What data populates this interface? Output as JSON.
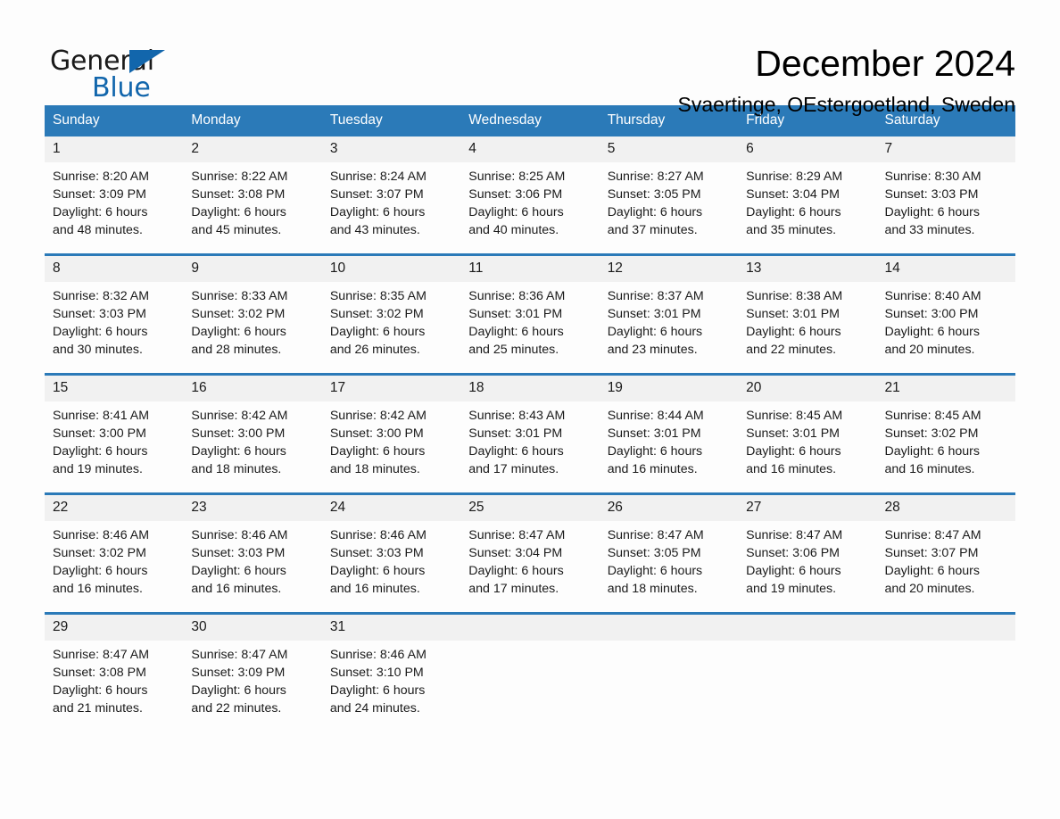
{
  "logo": {
    "word_one": "General",
    "word_two": "Blue",
    "flag_icon": "triangle-flag-icon"
  },
  "header": {
    "title": "December 2024",
    "subtitle": "Svaertinge, OEstergoetland, Sweden"
  },
  "colors": {
    "header_blue": "#2b7ab8",
    "logo_blue": "#1266ac",
    "daynum_band": "#f1f1f1",
    "page_background": "#fdfdfd"
  },
  "calendar": {
    "weekday_headers": [
      "Sunday",
      "Monday",
      "Tuesday",
      "Wednesday",
      "Thursday",
      "Friday",
      "Saturday"
    ],
    "weeks": [
      [
        {
          "day": "1",
          "sunrise": "Sunrise: 8:20 AM",
          "sunset": "Sunset: 3:09 PM",
          "daylight_line1": "Daylight: 6 hours",
          "daylight_line2": "and 48 minutes."
        },
        {
          "day": "2",
          "sunrise": "Sunrise: 8:22 AM",
          "sunset": "Sunset: 3:08 PM",
          "daylight_line1": "Daylight: 6 hours",
          "daylight_line2": "and 45 minutes."
        },
        {
          "day": "3",
          "sunrise": "Sunrise: 8:24 AM",
          "sunset": "Sunset: 3:07 PM",
          "daylight_line1": "Daylight: 6 hours",
          "daylight_line2": "and 43 minutes."
        },
        {
          "day": "4",
          "sunrise": "Sunrise: 8:25 AM",
          "sunset": "Sunset: 3:06 PM",
          "daylight_line1": "Daylight: 6 hours",
          "daylight_line2": "and 40 minutes."
        },
        {
          "day": "5",
          "sunrise": "Sunrise: 8:27 AM",
          "sunset": "Sunset: 3:05 PM",
          "daylight_line1": "Daylight: 6 hours",
          "daylight_line2": "and 37 minutes."
        },
        {
          "day": "6",
          "sunrise": "Sunrise: 8:29 AM",
          "sunset": "Sunset: 3:04 PM",
          "daylight_line1": "Daylight: 6 hours",
          "daylight_line2": "and 35 minutes."
        },
        {
          "day": "7",
          "sunrise": "Sunrise: 8:30 AM",
          "sunset": "Sunset: 3:03 PM",
          "daylight_line1": "Daylight: 6 hours",
          "daylight_line2": "and 33 minutes."
        }
      ],
      [
        {
          "day": "8",
          "sunrise": "Sunrise: 8:32 AM",
          "sunset": "Sunset: 3:03 PM",
          "daylight_line1": "Daylight: 6 hours",
          "daylight_line2": "and 30 minutes."
        },
        {
          "day": "9",
          "sunrise": "Sunrise: 8:33 AM",
          "sunset": "Sunset: 3:02 PM",
          "daylight_line1": "Daylight: 6 hours",
          "daylight_line2": "and 28 minutes."
        },
        {
          "day": "10",
          "sunrise": "Sunrise: 8:35 AM",
          "sunset": "Sunset: 3:02 PM",
          "daylight_line1": "Daylight: 6 hours",
          "daylight_line2": "and 26 minutes."
        },
        {
          "day": "11",
          "sunrise": "Sunrise: 8:36 AM",
          "sunset": "Sunset: 3:01 PM",
          "daylight_line1": "Daylight: 6 hours",
          "daylight_line2": "and 25 minutes."
        },
        {
          "day": "12",
          "sunrise": "Sunrise: 8:37 AM",
          "sunset": "Sunset: 3:01 PM",
          "daylight_line1": "Daylight: 6 hours",
          "daylight_line2": "and 23 minutes."
        },
        {
          "day": "13",
          "sunrise": "Sunrise: 8:38 AM",
          "sunset": "Sunset: 3:01 PM",
          "daylight_line1": "Daylight: 6 hours",
          "daylight_line2": "and 22 minutes."
        },
        {
          "day": "14",
          "sunrise": "Sunrise: 8:40 AM",
          "sunset": "Sunset: 3:00 PM",
          "daylight_line1": "Daylight: 6 hours",
          "daylight_line2": "and 20 minutes."
        }
      ],
      [
        {
          "day": "15",
          "sunrise": "Sunrise: 8:41 AM",
          "sunset": "Sunset: 3:00 PM",
          "daylight_line1": "Daylight: 6 hours",
          "daylight_line2": "and 19 minutes."
        },
        {
          "day": "16",
          "sunrise": "Sunrise: 8:42 AM",
          "sunset": "Sunset: 3:00 PM",
          "daylight_line1": "Daylight: 6 hours",
          "daylight_line2": "and 18 minutes."
        },
        {
          "day": "17",
          "sunrise": "Sunrise: 8:42 AM",
          "sunset": "Sunset: 3:00 PM",
          "daylight_line1": "Daylight: 6 hours",
          "daylight_line2": "and 18 minutes."
        },
        {
          "day": "18",
          "sunrise": "Sunrise: 8:43 AM",
          "sunset": "Sunset: 3:01 PM",
          "daylight_line1": "Daylight: 6 hours",
          "daylight_line2": "and 17 minutes."
        },
        {
          "day": "19",
          "sunrise": "Sunrise: 8:44 AM",
          "sunset": "Sunset: 3:01 PM",
          "daylight_line1": "Daylight: 6 hours",
          "daylight_line2": "and 16 minutes."
        },
        {
          "day": "20",
          "sunrise": "Sunrise: 8:45 AM",
          "sunset": "Sunset: 3:01 PM",
          "daylight_line1": "Daylight: 6 hours",
          "daylight_line2": "and 16 minutes."
        },
        {
          "day": "21",
          "sunrise": "Sunrise: 8:45 AM",
          "sunset": "Sunset: 3:02 PM",
          "daylight_line1": "Daylight: 6 hours",
          "daylight_line2": "and 16 minutes."
        }
      ],
      [
        {
          "day": "22",
          "sunrise": "Sunrise: 8:46 AM",
          "sunset": "Sunset: 3:02 PM",
          "daylight_line1": "Daylight: 6 hours",
          "daylight_line2": "and 16 minutes."
        },
        {
          "day": "23",
          "sunrise": "Sunrise: 8:46 AM",
          "sunset": "Sunset: 3:03 PM",
          "daylight_line1": "Daylight: 6 hours",
          "daylight_line2": "and 16 minutes."
        },
        {
          "day": "24",
          "sunrise": "Sunrise: 8:46 AM",
          "sunset": "Sunset: 3:03 PM",
          "daylight_line1": "Daylight: 6 hours",
          "daylight_line2": "and 16 minutes."
        },
        {
          "day": "25",
          "sunrise": "Sunrise: 8:47 AM",
          "sunset": "Sunset: 3:04 PM",
          "daylight_line1": "Daylight: 6 hours",
          "daylight_line2": "and 17 minutes."
        },
        {
          "day": "26",
          "sunrise": "Sunrise: 8:47 AM",
          "sunset": "Sunset: 3:05 PM",
          "daylight_line1": "Daylight: 6 hours",
          "daylight_line2": "and 18 minutes."
        },
        {
          "day": "27",
          "sunrise": "Sunrise: 8:47 AM",
          "sunset": "Sunset: 3:06 PM",
          "daylight_line1": "Daylight: 6 hours",
          "daylight_line2": "and 19 minutes."
        },
        {
          "day": "28",
          "sunrise": "Sunrise: 8:47 AM",
          "sunset": "Sunset: 3:07 PM",
          "daylight_line1": "Daylight: 6 hours",
          "daylight_line2": "and 20 minutes."
        }
      ],
      [
        {
          "day": "29",
          "sunrise": "Sunrise: 8:47 AM",
          "sunset": "Sunset: 3:08 PM",
          "daylight_line1": "Daylight: 6 hours",
          "daylight_line2": "and 21 minutes."
        },
        {
          "day": "30",
          "sunrise": "Sunrise: 8:47 AM",
          "sunset": "Sunset: 3:09 PM",
          "daylight_line1": "Daylight: 6 hours",
          "daylight_line2": "and 22 minutes."
        },
        {
          "day": "31",
          "sunrise": "Sunrise: 8:46 AM",
          "sunset": "Sunset: 3:10 PM",
          "daylight_line1": "Daylight: 6 hours",
          "daylight_line2": "and 24 minutes."
        },
        {
          "day": "",
          "sunrise": "",
          "sunset": "",
          "daylight_line1": "",
          "daylight_line2": ""
        },
        {
          "day": "",
          "sunrise": "",
          "sunset": "",
          "daylight_line1": "",
          "daylight_line2": ""
        },
        {
          "day": "",
          "sunrise": "",
          "sunset": "",
          "daylight_line1": "",
          "daylight_line2": ""
        },
        {
          "day": "",
          "sunrise": "",
          "sunset": "",
          "daylight_line1": "",
          "daylight_line2": ""
        }
      ]
    ]
  }
}
